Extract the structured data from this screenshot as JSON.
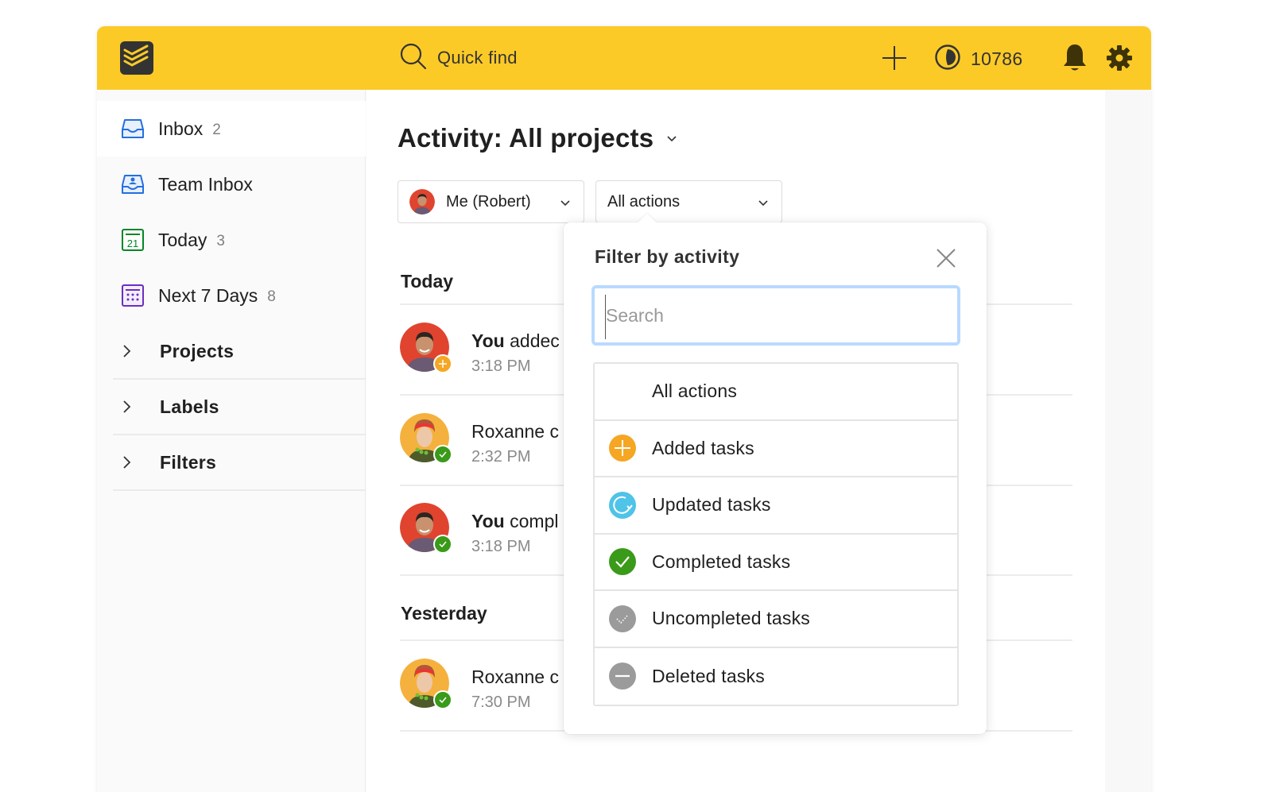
{
  "topbar": {
    "logo": "todoist-logo-icon",
    "search_label": "Quick find",
    "search_icon": "search-icon",
    "add_icon": "plus-icon",
    "karma_icon": "karma-pie-icon",
    "karma_score": "10786",
    "notifications_icon": "bell-icon",
    "settings_icon": "gear-icon",
    "brand_color": "#fcca27"
  },
  "sidebar": {
    "items": [
      {
        "label": "Inbox",
        "count": "2",
        "icon": "inbox-icon",
        "color": "#246fe0",
        "active": true
      },
      {
        "label": "Team Inbox",
        "count": "",
        "icon": "team-inbox-icon",
        "color": "#246fe0"
      },
      {
        "label": "Today",
        "count": "3",
        "icon": "calendar-today-icon",
        "color": "#058527",
        "day": "21"
      },
      {
        "label": "Next 7 Days",
        "count": "8",
        "icon": "calendar-week-icon",
        "color": "#692fc2"
      }
    ],
    "sections": [
      {
        "label": "Projects"
      },
      {
        "label": "Labels"
      },
      {
        "label": "Filters"
      }
    ]
  },
  "main": {
    "title": "Activity: All projects",
    "user_filter": {
      "value": "Me (Robert)"
    },
    "action_filter": {
      "value": "All actions"
    },
    "groups": [
      {
        "title": "Today",
        "events": [
          {
            "actor": "You",
            "text": "addec",
            "time": "3:18 PM",
            "avatar": "robert",
            "badge": "added"
          },
          {
            "actor": "",
            "text": "Roxanne c",
            "time": "2:32 PM",
            "avatar": "roxanne",
            "badge": "completed"
          },
          {
            "actor": "You",
            "text": "compl",
            "time": "3:18 PM",
            "avatar": "robert",
            "badge": "completed"
          }
        ]
      },
      {
        "title": "Yesterday",
        "events": [
          {
            "actor": "",
            "text": "Roxanne c",
            "time": "7:30 PM",
            "avatar": "roxanne",
            "badge": "completed"
          }
        ]
      }
    ]
  },
  "popover": {
    "title": "Filter by activity",
    "close_icon": "close-icon",
    "search_placeholder": "Search",
    "search_value": "",
    "options": [
      {
        "label": "All actions",
        "icon": ""
      },
      {
        "label": "Added tasks",
        "icon": "added-icon",
        "color": "#f5a623"
      },
      {
        "label": "Updated tasks",
        "icon": "updated-icon",
        "color": "#4fc3e8"
      },
      {
        "label": "Completed tasks",
        "icon": "completed-icon",
        "color": "#3a9a1a"
      },
      {
        "label": "Uncompleted tasks",
        "icon": "uncompleted-icon",
        "color": "#9b9b9b"
      },
      {
        "label": "Deleted tasks",
        "icon": "deleted-icon",
        "color": "#9b9b9b"
      }
    ]
  }
}
